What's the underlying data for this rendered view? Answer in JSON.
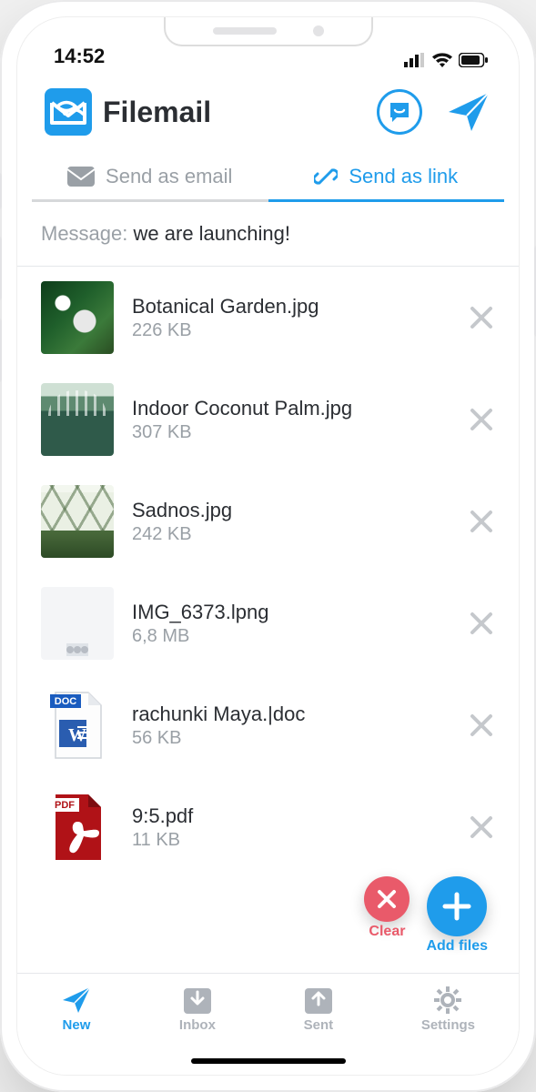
{
  "status": {
    "time": "14:52"
  },
  "header": {
    "brand": "Filemail"
  },
  "tabs": {
    "email": "Send as email",
    "link": "Send as link",
    "active": "link"
  },
  "message": {
    "label": "Message:",
    "value": "we are launching!"
  },
  "files": [
    {
      "name": "Botanical Garden.jpg",
      "size": "226 KB",
      "kind": "botanical"
    },
    {
      "name": "Indoor Coconut Palm.jpg",
      "size": "307 KB",
      "kind": "indoor"
    },
    {
      "name": "Sadnos.jpg",
      "size": "242 KB",
      "kind": "sadnos"
    },
    {
      "name": "IMG_6373.lpng",
      "size": "6,8 MB",
      "kind": "img6373"
    },
    {
      "name": "rachunki Maya.|doc",
      "size": "56 KB",
      "kind": "doc"
    },
    {
      "name": "9:5.pdf",
      "size": "11 KB",
      "kind": "pdf"
    }
  ],
  "fab": {
    "clear": "Clear",
    "add": "Add files"
  },
  "nav": {
    "new": "New",
    "inbox": "Inbox",
    "sent": "Sent",
    "settings": "Settings",
    "active": "new"
  },
  "icons": {
    "doc_badge": "DOC",
    "pdf_badge": "PDF"
  }
}
